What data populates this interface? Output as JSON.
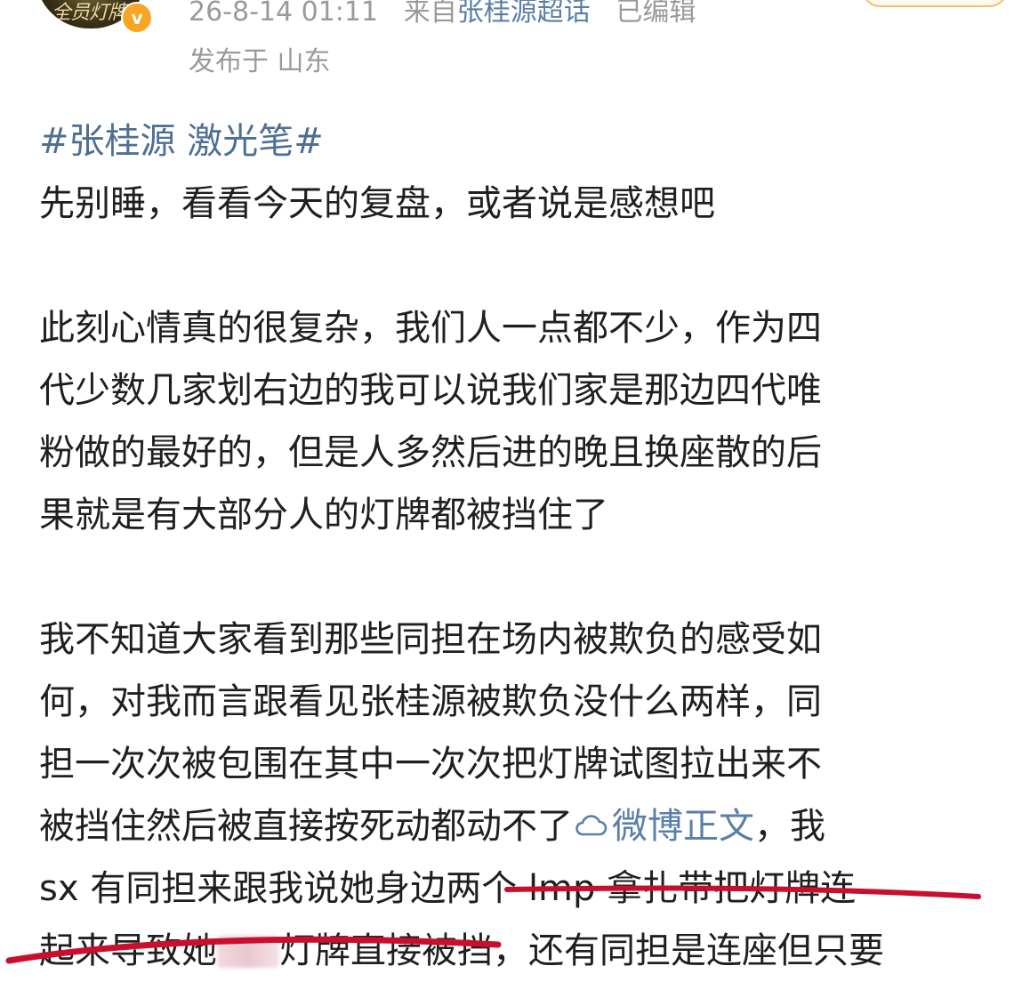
{
  "header": {
    "meta_time": "26-8-14 01:11",
    "meta_from_prefix": "来自",
    "meta_source": "张桂源超话",
    "meta_edited": "已编辑",
    "location": "发布于 山东",
    "avatar_text": "全员灯牌"
  },
  "post": {
    "hashtag": "#张桂源 激光笔#",
    "line1": "先别睡，看看今天的复盘，或者说是感想吧",
    "para2": [
      "此刻心情真的很复杂，我们人一点都不少，作为四",
      "代少数几家划右边的我可以说我们家是那边四代唯",
      "粉做的最好的，但是人多然后进的晚且换座散的后",
      "果就是有大部分人的灯牌都被挡住了"
    ],
    "para3_lines": [
      "我不知道大家看到那些同担在场内被欺负的感受如",
      "何，对我而言跟看见张桂源被欺负没什么两样，同",
      "担一次次被包围在其中一次次把灯牌试图拉出来不"
    ],
    "line_before_link": "被挡住然后被直接按死动都动不了",
    "link_text": "微博正文",
    "line_after_link": "，我",
    "line_sx": " sx 有同担来跟我说她身边两个 lmp 拿扎带把灯牌连",
    "line_last_start": "起来导致她",
    "line_last_mid": "灯牌直接被挡",
    "line_last_end": "，还有同担是连座但只要"
  },
  "colors": {
    "link": "#5a7fa8",
    "hashtag": "#4e6f94",
    "underline": "#c8102e",
    "meta": "#9a9a9a"
  }
}
